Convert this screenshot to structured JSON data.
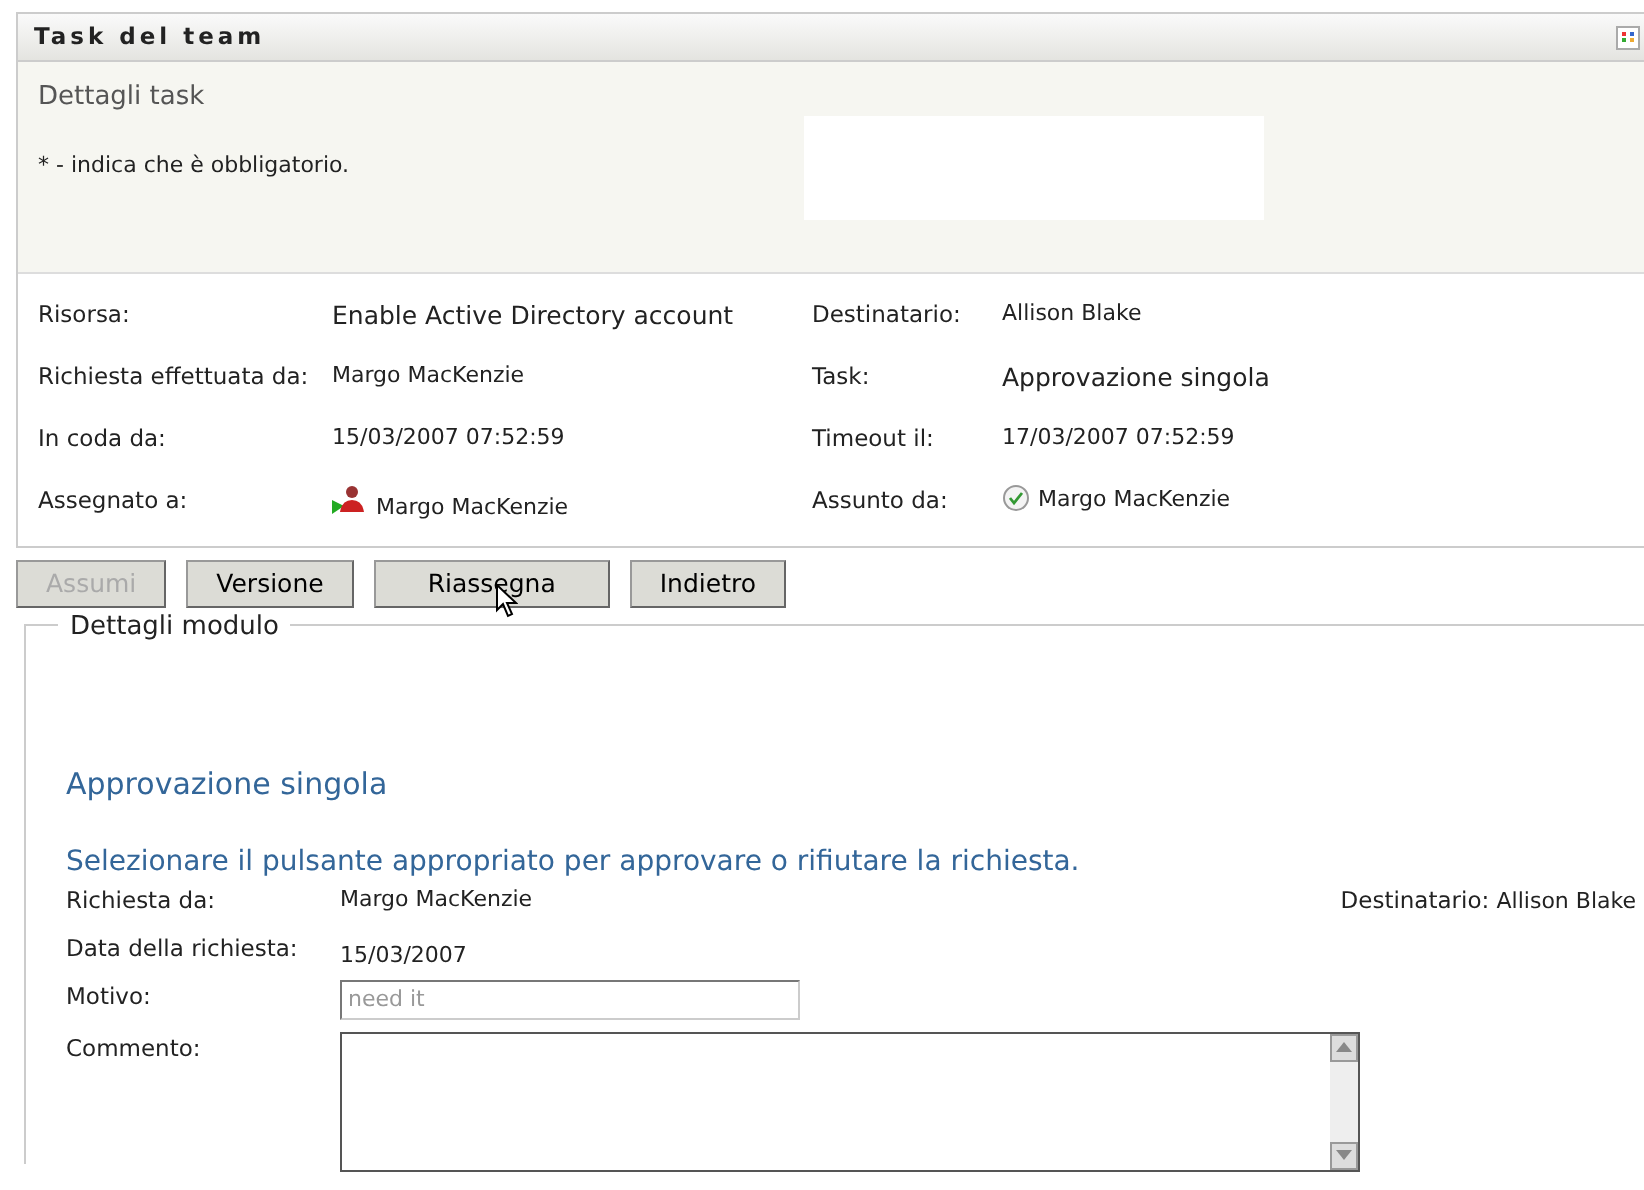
{
  "panel": {
    "title": "Task del team"
  },
  "header": {
    "title": "Dettagli task",
    "required_note": "* - indica che è obbligatorio."
  },
  "details": [
    {
      "label": "Risorsa:",
      "value": "Enable Active Directory account",
      "kind": "large"
    },
    {
      "label": "Destinatario:",
      "value": "Allison Blake",
      "kind": "small"
    },
    {
      "label": "Richiesta effettuata da:",
      "value": "Margo MacKenzie",
      "kind": "small"
    },
    {
      "label": "Task:",
      "value": "Approvazione singola",
      "kind": "large"
    },
    {
      "label": "In coda da:",
      "value": "15/03/2007 07:52:59",
      "kind": "small"
    },
    {
      "label": "Timeout il:",
      "value": "17/03/2007 07:52:59",
      "kind": "small"
    },
    {
      "label": "Assegnato a:",
      "value": "Margo MacKenzie",
      "kind": "group"
    },
    {
      "label": "Assunto da:",
      "value": "Margo MacKenzie",
      "kind": "check"
    }
  ],
  "buttons": [
    {
      "label": "Assumi",
      "disabled": true
    },
    {
      "label": "Versione",
      "disabled": false
    },
    {
      "label": "Riassegna",
      "disabled": false,
      "hovered": true
    },
    {
      "label": "Indietro",
      "disabled": false
    }
  ],
  "form": {
    "legend": "Dettagli modulo",
    "title": "Approvazione singola",
    "instruction": "Selezionare il pulsante appropriato per approvare o rifiutare la richiesta.",
    "requested_by_label": "Richiesta da:",
    "requested_by": "Margo MacKenzie",
    "recipient_label": "Destinatario:",
    "recipient": "Allison Blake",
    "date_label": "Data della richiesta:",
    "date": "15/03/2007",
    "reason_label": "Motivo:",
    "reason": "need it",
    "reason_disabled": true,
    "comment_label": "Commento:"
  }
}
